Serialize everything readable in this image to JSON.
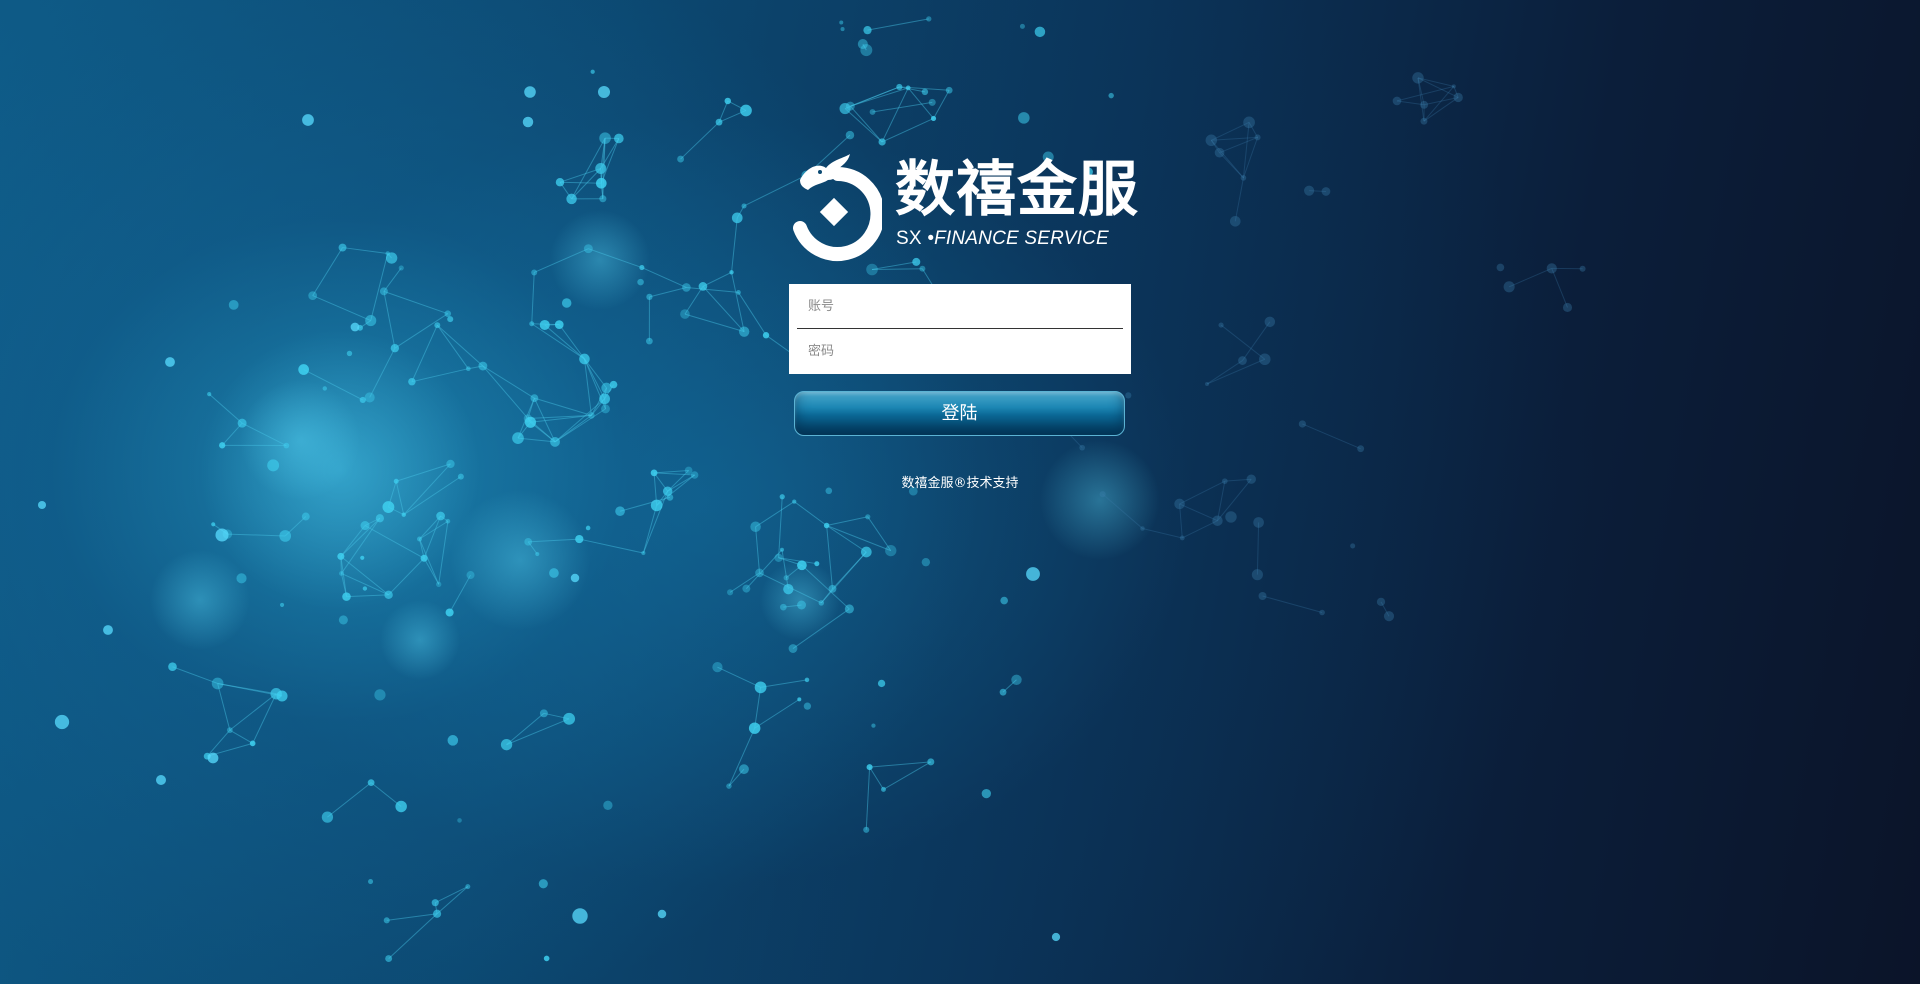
{
  "brand": {
    "title": "数禧金服",
    "subtitle_prefix": "SX",
    "subtitle_suffix": "FINANCE SERVICE",
    "separator": "•"
  },
  "form": {
    "account_placeholder": "账号",
    "password_placeholder": "密码",
    "login_label": "登陆"
  },
  "footer": {
    "support_text": "数禧金服®技术支持"
  },
  "colors": {
    "background_dark": "#0b1429",
    "background_light": "#0e5a86",
    "accent": "#1d87b4",
    "node": "#3fd2f2"
  }
}
